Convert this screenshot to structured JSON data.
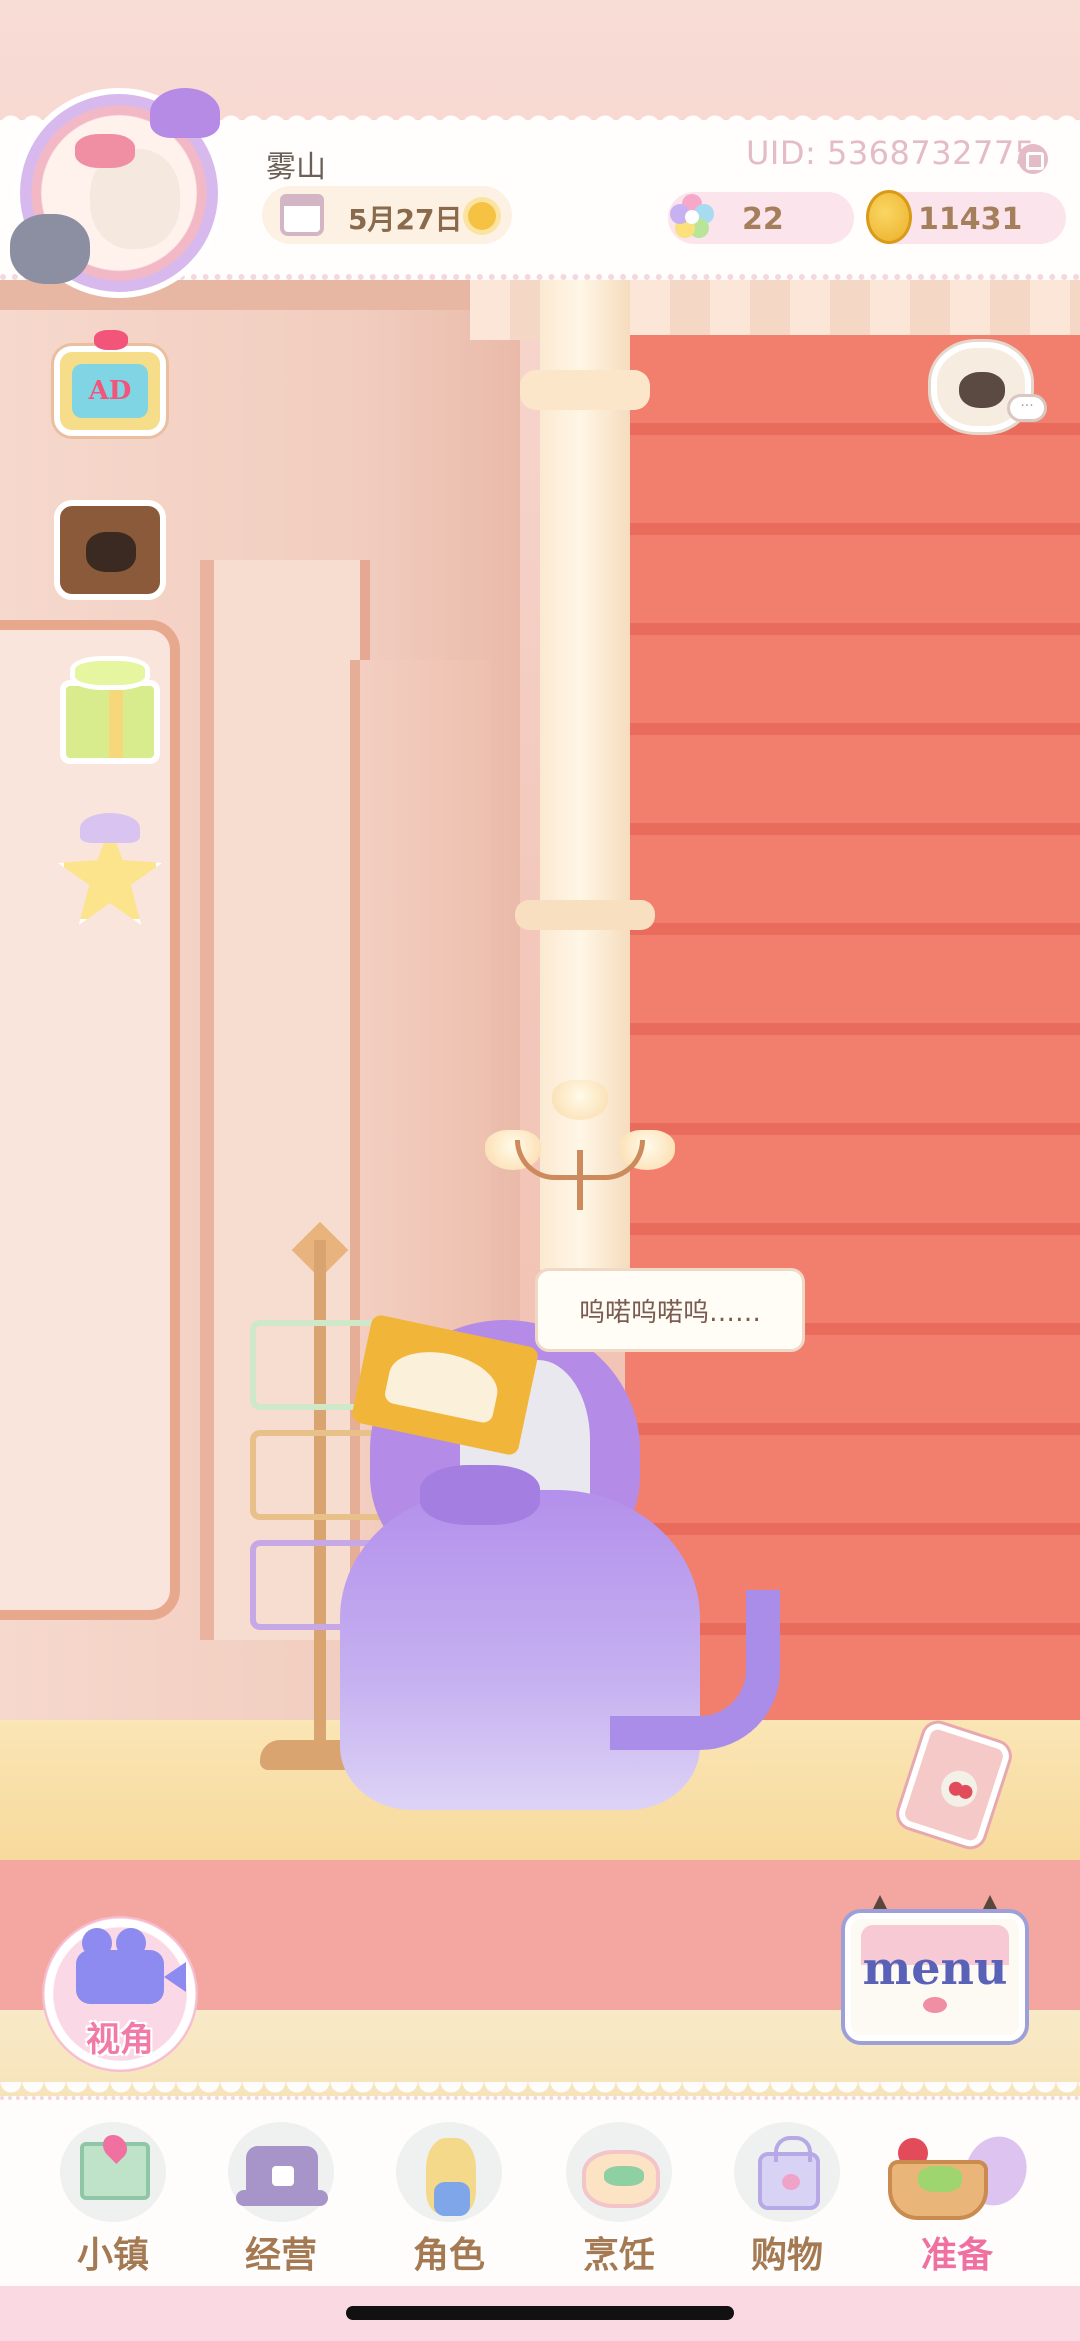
{
  "header": {
    "username": "雾山",
    "uid": "UID: 5368732775",
    "date": "5月27日",
    "weather_icon": "sun-icon",
    "gems": "22",
    "coins": "11431"
  },
  "side_buttons": {
    "ad_label": "AD"
  },
  "speech_bubble": "呜喏呜喏呜……",
  "view_button_label": "视角",
  "menu_button_label": "menu",
  "bottom_nav": {
    "items": [
      {
        "label": "小镇",
        "icon": "map-icon"
      },
      {
        "label": "经营",
        "icon": "hat-lock-icon"
      },
      {
        "label": "角色",
        "icon": "doll-icon"
      },
      {
        "label": "烹饪",
        "icon": "cake-icon"
      },
      {
        "label": "购物",
        "icon": "bag-icon"
      },
      {
        "label": "准备",
        "icon": "basket-icon"
      }
    ],
    "active_index": 5
  },
  "colors": {
    "accent_pink": "#f0719f",
    "nav_text": "#a57a52",
    "menu_blue": "#5a62b8"
  }
}
